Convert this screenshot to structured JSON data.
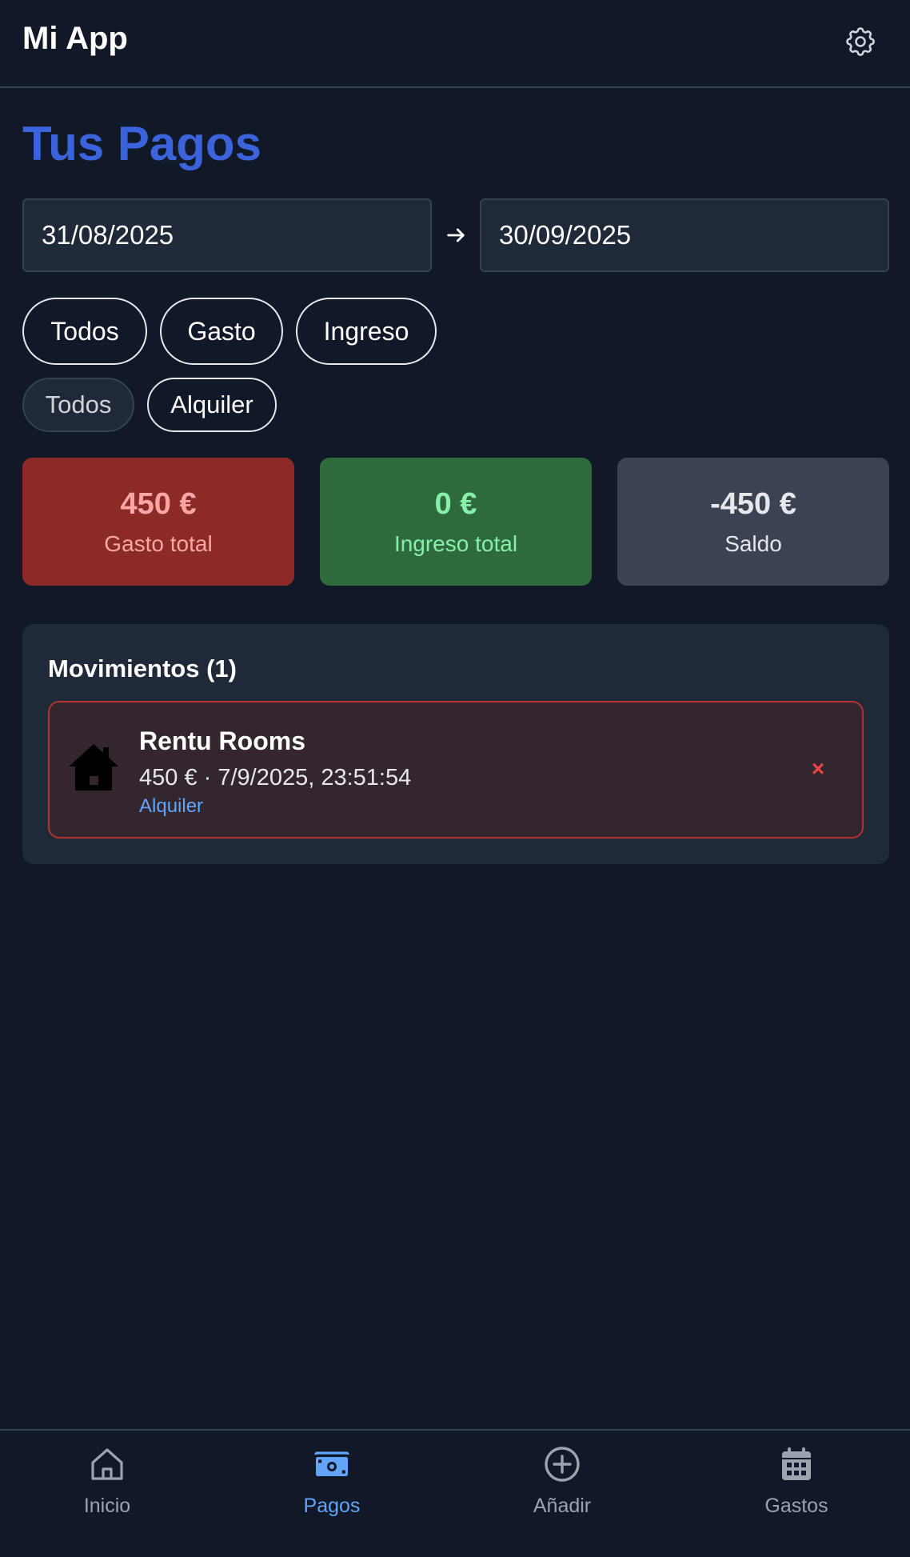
{
  "header": {
    "app_title": "Mi App",
    "settings_icon": "gear-icon"
  },
  "page": {
    "title": "Tus Pagos"
  },
  "date_range": {
    "from": "31/08/2025",
    "to": "30/09/2025",
    "separator_icon": "arrow-right-icon"
  },
  "type_filters": [
    {
      "label": "Todos"
    },
    {
      "label": "Gasto"
    },
    {
      "label": "Ingreso"
    }
  ],
  "category_filters": [
    {
      "label": "Todos",
      "active": true
    },
    {
      "label": "Alquiler",
      "active": false
    }
  ],
  "summary": {
    "gasto": {
      "amount": "450 €",
      "label": "Gasto total",
      "color": "#8b2a26"
    },
    "ingreso": {
      "amount": "0 €",
      "label": "Ingreso total",
      "color": "#2f6a3d"
    },
    "saldo": {
      "amount": "-450 €",
      "label": "Saldo",
      "color": "#3b4252"
    }
  },
  "movements": {
    "title": "Movimientos (1)",
    "items": [
      {
        "icon": "house-icon",
        "name": "Rentu Rooms",
        "details": "450 € · 7/9/2025, 23:51:54",
        "category": "Alquiler",
        "delete_label": "×"
      }
    ]
  },
  "bottom_nav": {
    "items": [
      {
        "label": "Inicio",
        "icon": "home-icon"
      },
      {
        "label": "Pagos",
        "icon": "banknote-icon",
        "active": true
      },
      {
        "label": "Añadir",
        "icon": "plus-circle-icon"
      },
      {
        "label": "Gastos",
        "icon": "calendar-icon"
      }
    ]
  },
  "colors": {
    "background": "#111827",
    "accent": "#3b63db",
    "nav_active": "#60a5fa",
    "danger": "#ef4444"
  }
}
